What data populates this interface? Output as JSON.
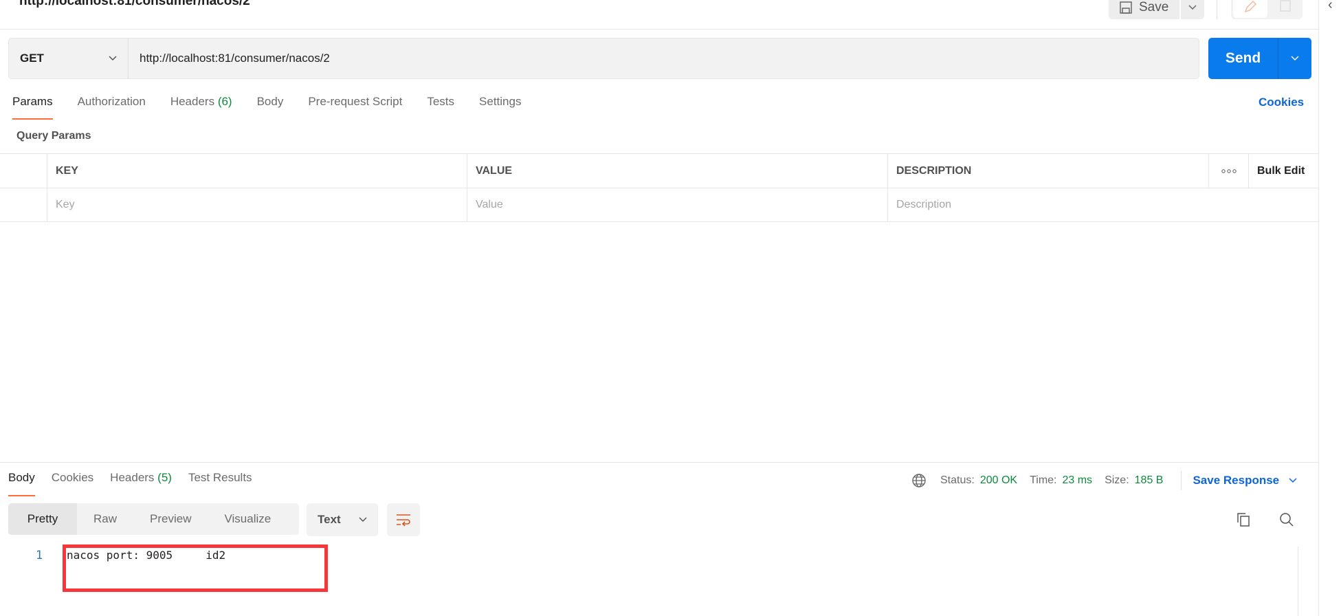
{
  "header": {
    "title": "http://localhost:81/consumer/nacos/2",
    "save_label": "Save"
  },
  "request": {
    "method": "GET",
    "url": "http://localhost:81/consumer/nacos/2",
    "send_label": "Send"
  },
  "tabs": [
    {
      "label": "Params",
      "count": ""
    },
    {
      "label": "Authorization",
      "count": ""
    },
    {
      "label": "Headers",
      "count": "(6)"
    },
    {
      "label": "Body",
      "count": ""
    },
    {
      "label": "Pre-request Script",
      "count": ""
    },
    {
      "label": "Tests",
      "count": ""
    },
    {
      "label": "Settings",
      "count": ""
    }
  ],
  "cookies_label": "Cookies",
  "query_params": {
    "title": "Query Params",
    "columns": [
      "KEY",
      "VALUE",
      "DESCRIPTION"
    ],
    "bulk_edit": "Bulk Edit",
    "placeholders": [
      "Key",
      "Value",
      "Description"
    ]
  },
  "response": {
    "tabs": [
      {
        "label": "Body",
        "count": ""
      },
      {
        "label": "Cookies",
        "count": ""
      },
      {
        "label": "Headers",
        "count": "(5)"
      },
      {
        "label": "Test Results",
        "count": ""
      }
    ],
    "status_label": "Status:",
    "status": "200 OK",
    "time_label": "Time:",
    "time": "23 ms",
    "size_label": "Size:",
    "size": "185 B",
    "save_response": "Save Response",
    "formats": [
      "Pretty",
      "Raw",
      "Preview",
      "Visualize"
    ],
    "type": "Text",
    "line_number": "1",
    "body": "nacos port: 9005     id2"
  },
  "colors": {
    "accent": "#ff6c37",
    "send": "#097bed",
    "link": "#0d65d6",
    "success": "#0c8a3c",
    "highlight_box": "#f7363a"
  }
}
